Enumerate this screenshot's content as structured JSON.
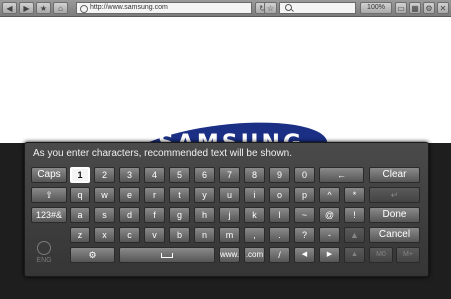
{
  "browser": {
    "url": "http://www.samsung.com",
    "zoom": "100%"
  },
  "page": {
    "logo_text": "SAMSUNG"
  },
  "keyboard": {
    "hint": "As you enter characters, recommended text will be shown.",
    "row1": {
      "caps": "Caps",
      "keys": [
        "1",
        "2",
        "3",
        "4",
        "5",
        "6",
        "7",
        "8",
        "9",
        "0"
      ],
      "backspace": "←",
      "clear": "Clear"
    },
    "row2": {
      "shift": "⇧",
      "keys": [
        "q",
        "w",
        "e",
        "r",
        "t",
        "y",
        "u",
        "i",
        "o",
        "p",
        "^",
        "*"
      ],
      "enter": "↵"
    },
    "row3": {
      "symbols": "123#&",
      "keys": [
        "a",
        "s",
        "d",
        "f",
        "g",
        "h",
        "j",
        "k",
        "l",
        "~",
        "@",
        "!"
      ],
      "done": "Done"
    },
    "row4": {
      "keys": [
        "z",
        "x",
        "c",
        "v",
        "b",
        "n",
        "m",
        ",",
        ".",
        "?",
        "-",
        "▲"
      ],
      "cancel": "Cancel"
    },
    "row5": {
      "settings": "⚙",
      "www": "www.",
      "com": ".com",
      "slash": "/",
      "left": "◀",
      "right": "▶",
      "up_dim": "▲",
      "fn1": "M0",
      "fn2": "M+"
    },
    "lang": "ENG"
  }
}
